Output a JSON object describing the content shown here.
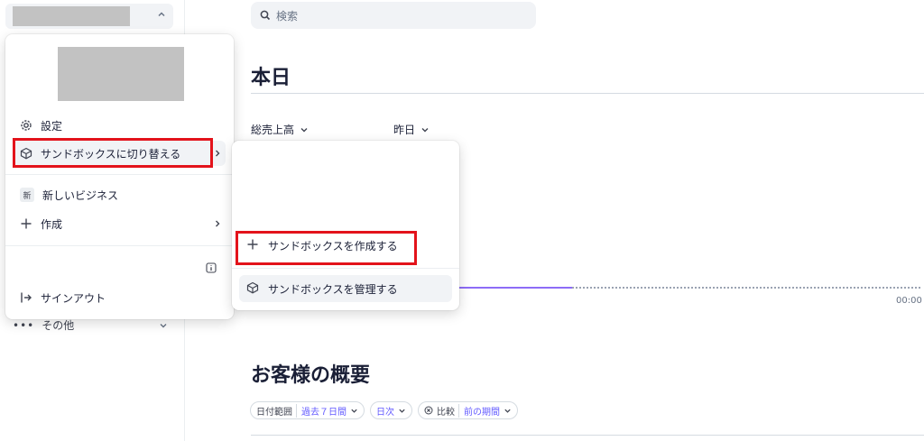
{
  "search": {
    "placeholder": "検索"
  },
  "main": {
    "today_heading": "本日",
    "metric_gross": "総売上高",
    "metric_yesterday": "昨日",
    "time_label": "00:00",
    "customers_heading": "お客様の概要"
  },
  "filters": {
    "date_range_label": "日付範囲",
    "date_range_value": "過去７日間",
    "interval_value": "日次",
    "compare_label": "比較",
    "compare_value": "前の期間"
  },
  "sidebar": {
    "more_label": "その他"
  },
  "account_menu": {
    "settings": "設定",
    "switch_sandbox": "サンドボックスに切り替える",
    "new_business_badge": "新",
    "new_business": "新しいビジネス",
    "create": "作成",
    "sign_out": "サインアウト"
  },
  "sandbox_submenu": {
    "create": "サンドボックスを作成する",
    "manage": "サンドボックスを管理する"
  },
  "colors": {
    "accent": "#635bff",
    "chart_line": "#8d6cf7",
    "highlight_box": "#e3131b"
  }
}
